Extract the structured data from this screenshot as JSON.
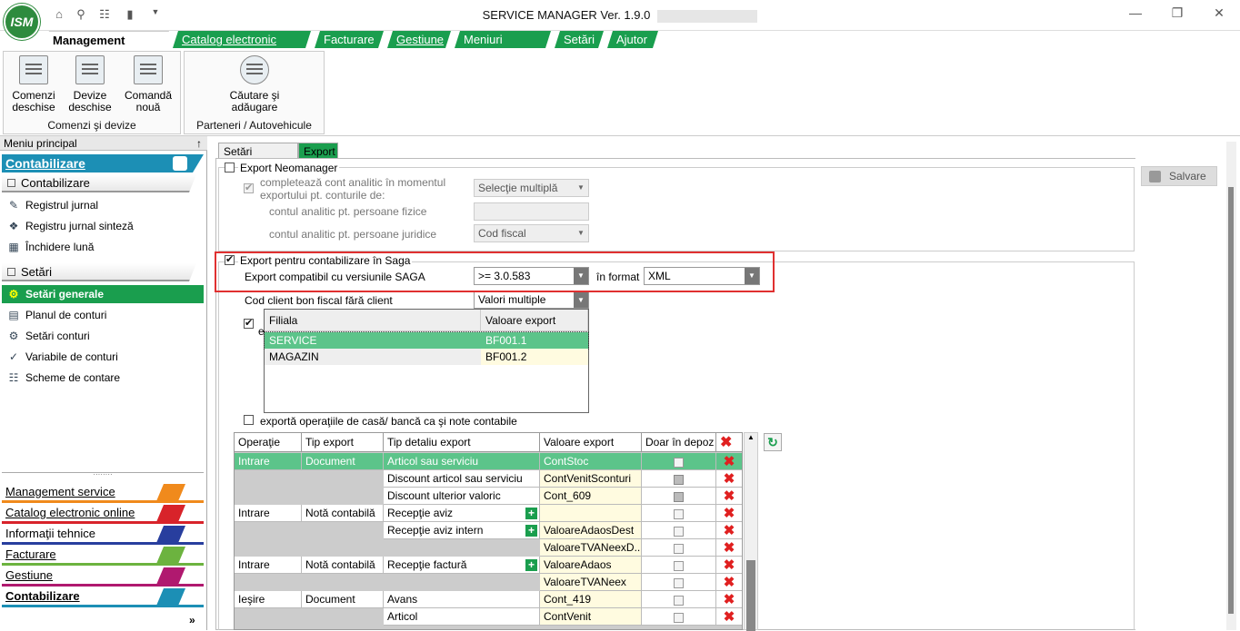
{
  "app": {
    "title": "SERVICE MANAGER Ver. 1.9.0",
    "logo_text": "ISM"
  },
  "ribbon_tabs": [
    {
      "label": "Management service",
      "active": true
    },
    {
      "label": "Catalog electronic online"
    },
    {
      "label": "Facturare"
    },
    {
      "label": "Gestiune"
    },
    {
      "label": "Meniuri favorite"
    },
    {
      "label": "Setări"
    },
    {
      "label": "Ajutor"
    }
  ],
  "ribbon": {
    "groups": [
      {
        "label": "Comenzi şi devize",
        "buttons": [
          {
            "label": "Comenzi deschise"
          },
          {
            "label": "Devize deschise"
          },
          {
            "label": "Comandă nouă"
          }
        ]
      },
      {
        "label": "Parteneri / Autovehicule",
        "buttons": [
          {
            "label": "Căutare şi adăugare"
          }
        ]
      }
    ]
  },
  "sidebar": {
    "header": "Meniu principal",
    "pin": "↑",
    "top_band": "Contabilizare",
    "section1": "Contabilizare",
    "items1": [
      {
        "label": "Registrul jurnal",
        "icon": "journal-icon"
      },
      {
        "label": "Registru jurnal sinteză",
        "icon": "journal-sum-icon"
      },
      {
        "label": "Închidere lună",
        "icon": "calendar-icon"
      }
    ],
    "section2": "Setări",
    "items2": [
      {
        "label": "Setări generale",
        "icon": "key-icon",
        "selected": true
      },
      {
        "label": "Planul de conturi",
        "icon": "chart-accounts-icon"
      },
      {
        "label": "Setări conturi",
        "icon": "gears-icon"
      },
      {
        "label": "Variabile de conturi",
        "icon": "variables-icon"
      },
      {
        "label": "Scheme de contare",
        "icon": "scheme-icon"
      }
    ],
    "nav": [
      {
        "label": "Management service",
        "color": "#f08a1c"
      },
      {
        "label": "Catalog electronic online",
        "color": "#d8232a"
      },
      {
        "label": "Informaţii tehnice",
        "color": "#283e9e"
      },
      {
        "label": "Facturare",
        "color": "#6cb33f"
      },
      {
        "label": "Gestiune",
        "color": "#b0196f"
      },
      {
        "label": "Contabilizare",
        "color": "#1c8fb5",
        "active": true
      }
    ],
    "expand": "»"
  },
  "content_tabs": [
    {
      "label": "Setări generale"
    },
    {
      "label": "Export",
      "active": true
    }
  ],
  "save_button": "Salvare",
  "neomanager": {
    "label": "Export Neomanager",
    "checked": false,
    "analytic_label": "completează cont analitic în momentul exportului pt. conturile de:",
    "analytic_value": "Selecţie multiplă",
    "pf_label": "contul analitic pt. persoane fizice",
    "pj_label": "contul analitic pt. persoane juridice",
    "pj_value": "Cod fiscal"
  },
  "saga": {
    "label": "Export pentru contabilizare în Saga",
    "checked": true,
    "version_label": "Export compatibil cu versiunile SAGA",
    "version_value": ">= 3.0.583",
    "format_label": "în format",
    "format_value": "XML",
    "cod_client_label": "Cod client bon fiscal fără client",
    "cod_client_value": "Valori multiple",
    "hidden_cb_letter": "e",
    "popup": {
      "headers": [
        "Filiala",
        "Valoare export"
      ],
      "rows": [
        {
          "filiala": "SERVICE",
          "valoare": "BF001.1",
          "selected": true
        },
        {
          "filiala": "MAGAZIN",
          "valoare": "BF001.2"
        }
      ]
    },
    "casa_label": "exportă operaţiile de casă/ bancă ca şi note contabile"
  },
  "grid": {
    "headers": [
      "Operaţie",
      "Tip export",
      "Tip detaliu export",
      "Valoare export",
      "Doar în depoz"
    ],
    "rows": [
      {
        "op": "Intrare",
        "tip": "Document",
        "detaliu": "Articol sau serviciu",
        "valoare": "ContStoc",
        "sel": true
      },
      {
        "op": "",
        "tip": "",
        "detaliu": "Discount articol sau serviciu",
        "valoare": "ContVenitSconturi"
      },
      {
        "op": "",
        "tip": "",
        "detaliu": "Discount ulterior valoric",
        "valoare": "Cont_609"
      },
      {
        "op": "Intrare",
        "tip": "Notă contabilă",
        "detaliu": "Recepţie aviz",
        "valoare": "",
        "plus": true
      },
      {
        "op": "",
        "tip": "",
        "detaliu": "Recepţie aviz intern",
        "valoare": "ValoareAdaosDest",
        "plus": true
      },
      {
        "op": "",
        "tip": "",
        "detaliu": "",
        "valoare": "ValoareTVANeexD..."
      },
      {
        "op": "Intrare",
        "tip": "Notă contabilă",
        "detaliu": "Recepţie factură",
        "valoare": "ValoareAdaos",
        "plus": true
      },
      {
        "op": "",
        "tip": "",
        "detaliu": "",
        "valoare": "ValoareTVANeex"
      },
      {
        "op": "Ieşire",
        "tip": "Document",
        "detaliu": "Avans",
        "valoare": "Cont_419"
      },
      {
        "op": "",
        "tip": "",
        "detaliu": "Articol",
        "valoare": "ContVenit"
      }
    ]
  }
}
